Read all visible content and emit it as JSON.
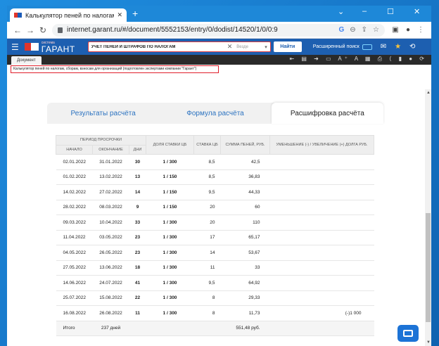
{
  "browser": {
    "tab_title": "Калькулятор пеней по налогам",
    "tab_close": "✕",
    "new_tab": "+",
    "url": "internet.garant.ru/#/document/5552153/entry/0/dodist/14520/1/0/0:9",
    "window_controls": [
      "⌄",
      "–",
      "☐",
      "✕"
    ]
  },
  "garant": {
    "logo_system": "система",
    "logo_name": "ГАРАНТ",
    "search_value": "УЧЕТ ПЕНЕЙ И ШТРАФОВ ПО НАЛОГАМ",
    "search_clear": "✕",
    "where_placeholder": "Везде",
    "find_button": "Найти",
    "extended_search": "Расширенный поиск"
  },
  "document": {
    "tab_label": "Документ",
    "tools": "⇤ ▤ ➜ ▭ A⁺ A ▦ ⎙ ⟨ ▮ ● ⟳",
    "breadcrumb": "Калькулятор пеней по налогам, сборам, взносам для организаций (подготовлен экспертами компании \"Гарант\")"
  },
  "calc": {
    "tabs": [
      {
        "label": "Результаты расчёта",
        "active": false
      },
      {
        "label": "Формула расчёта",
        "active": false
      },
      {
        "label": "Расшифровка расчёта",
        "active": true
      }
    ],
    "headers": {
      "period": "ПЕРИОД ПРОСРОЧКИ",
      "start": "НАЧАЛО",
      "end": "ОКОНЧАНИЕ",
      "days": "ДНИ",
      "share": "ДОЛЯ СТАВКИ ЦБ",
      "rate": "СТАВКА ЦБ",
      "sum": "СУММА ПЕНЕЙ, РУБ.",
      "change": "УМЕНЬШЕНИЕ (-) / УВЕЛИЧЕНИЕ (+) ДОЛГА РУБ."
    },
    "rows": [
      {
        "start": "02.01.2022",
        "end": "31.01.2022",
        "days": "30",
        "share": "1 / 300",
        "rate": "8,5",
        "sum": "42,5",
        "change": ""
      },
      {
        "start": "01.02.2022",
        "end": "13.02.2022",
        "days": "13",
        "share": "1 / 150",
        "rate": "8,5",
        "sum": "36,83",
        "change": ""
      },
      {
        "start": "14.02.2022",
        "end": "27.02.2022",
        "days": "14",
        "share": "1 / 150",
        "rate": "9,5",
        "sum": "44,33",
        "change": ""
      },
      {
        "start": "28.02.2022",
        "end": "08.03.2022",
        "days": "9",
        "share": "1 / 150",
        "rate": "20",
        "sum": "60",
        "change": ""
      },
      {
        "start": "09.03.2022",
        "end": "10.04.2022",
        "days": "33",
        "share": "1 / 300",
        "rate": "20",
        "sum": "110",
        "change": ""
      },
      {
        "start": "11.04.2022",
        "end": "03.05.2022",
        "days": "23",
        "share": "1 / 300",
        "rate": "17",
        "sum": "65,17",
        "change": ""
      },
      {
        "start": "04.05.2022",
        "end": "26.05.2022",
        "days": "23",
        "share": "1 / 300",
        "rate": "14",
        "sum": "53,67",
        "change": ""
      },
      {
        "start": "27.05.2022",
        "end": "13.06.2022",
        "days": "18",
        "share": "1 / 300",
        "rate": "11",
        "sum": "33",
        "change": ""
      },
      {
        "start": "14.06.2022",
        "end": "24.07.2022",
        "days": "41",
        "share": "1 / 300",
        "rate": "9,5",
        "sum": "64,92",
        "change": ""
      },
      {
        "start": "25.07.2022",
        "end": "15.08.2022",
        "days": "22",
        "share": "1 / 300",
        "rate": "8",
        "sum": "29,33",
        "change": ""
      },
      {
        "start": "16.08.2022",
        "end": "26.08.2022",
        "days": "11",
        "share": "1 / 300",
        "rate": "8",
        "sum": "11,73",
        "change": "(-)1 000"
      }
    ],
    "total": {
      "label": "Итого",
      "days": "237 дней",
      "sum": "551,48 руб."
    }
  }
}
